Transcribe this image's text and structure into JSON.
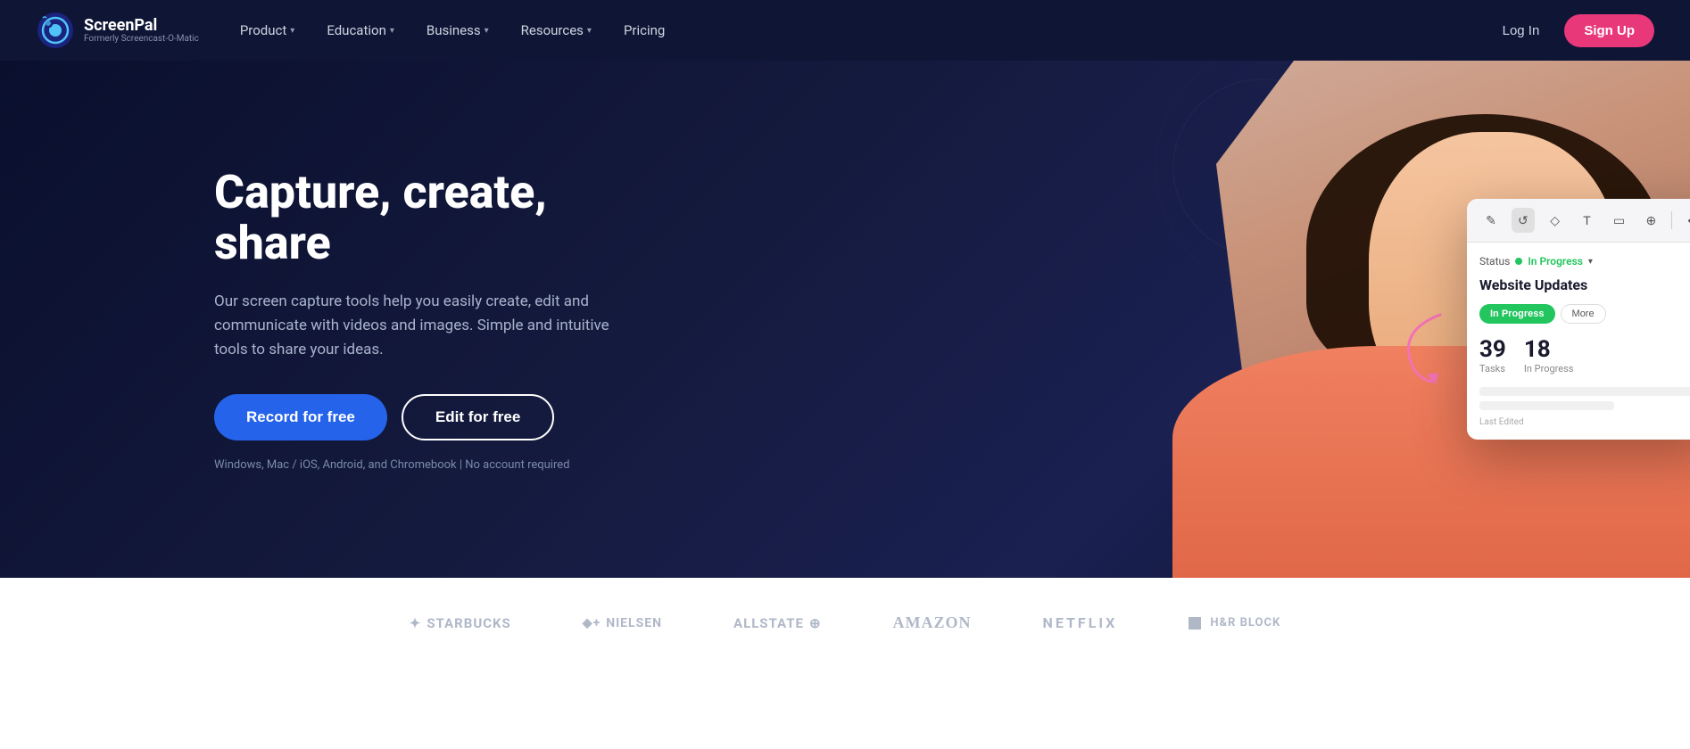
{
  "nav": {
    "logo_title": "ScreenPal",
    "logo_subtitle": "Formerly Screencast-O-Matic",
    "links": [
      {
        "label": "Product",
        "has_dropdown": true
      },
      {
        "label": "Education",
        "has_dropdown": true
      },
      {
        "label": "Business",
        "has_dropdown": true
      },
      {
        "label": "Resources",
        "has_dropdown": true
      },
      {
        "label": "Pricing",
        "has_dropdown": false
      }
    ],
    "login_label": "Log In",
    "signup_label": "Sign Up"
  },
  "hero": {
    "title": "Capture, create, share",
    "subtitle": "Our screen capture tools help you easily create, edit and communicate with videos and images. Simple and intuitive tools to share your ideas.",
    "record_btn": "Record for free",
    "edit_btn": "Edit for free",
    "footnote": "Windows, Mac / iOS, Android, and Chromebook  |  No account required"
  },
  "mockup": {
    "toolbar_tools": [
      "✏️",
      "⟳",
      "◇",
      "T",
      "▭",
      "🔍",
      "↩"
    ],
    "status_label": "Status",
    "status_value": "In Progress",
    "card_title": "Website Updates",
    "tab_active": "In Progress",
    "tab_inactive": "More",
    "stat1_num": "39",
    "stat1_label": "Tasks",
    "stat2_num": "18",
    "stat2_label": "In Progress",
    "last_edited_label": "Last Edited"
  },
  "logos": [
    {
      "name": "starbucks",
      "text": "STARBUCKS"
    },
    {
      "name": "nielsen",
      "text": "◆+ Nielsen"
    },
    {
      "name": "allstate",
      "text": "Allstate ⊕"
    },
    {
      "name": "amazon",
      "text": "amazon"
    },
    {
      "name": "netflix",
      "text": "NETFLIX"
    },
    {
      "name": "hrblock",
      "text": "▪ H&R BLOCK"
    }
  ]
}
